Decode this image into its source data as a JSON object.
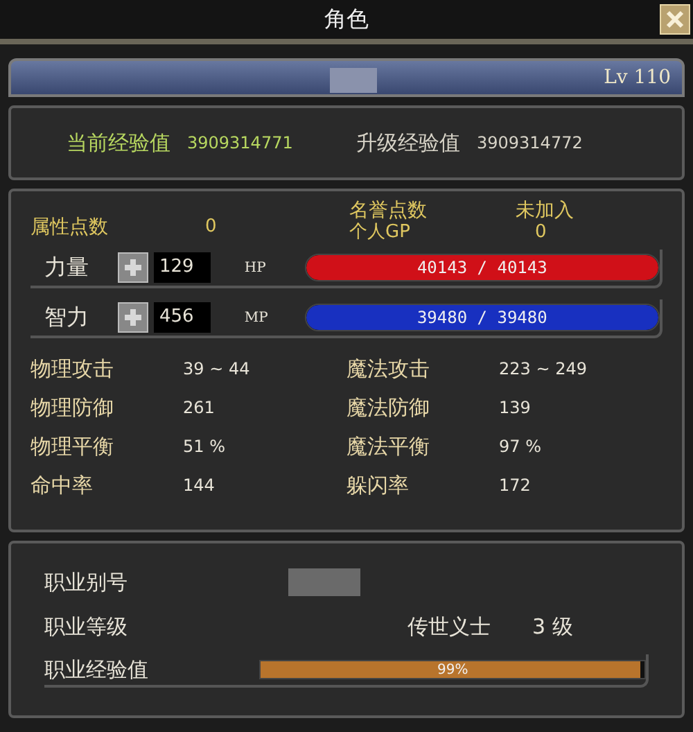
{
  "window": {
    "title": "角色"
  },
  "level_bar": {
    "level_text": "Lv 110"
  },
  "experience": {
    "current_label": "当前经验值",
    "current_value": "3909314771",
    "next_label": "升级经验值",
    "next_value": "3909314772"
  },
  "points": {
    "attr_label": "属性点数",
    "attr_value": "0",
    "honor_label": "名誉点数",
    "honor_value": "未加入",
    "gp_label": "个人GP",
    "gp_value": "0"
  },
  "resources": [
    {
      "stat_label": "力量",
      "stat_value": "129",
      "bar_label": "HP",
      "reading": "40143 / 40143",
      "level": 1.0,
      "color": "#d01018"
    },
    {
      "stat_label": "智力",
      "stat_value": "456",
      "bar_label": "MP",
      "reading": "39480 / 39480",
      "level": 1.0,
      "color": "#1830c0"
    }
  ],
  "stats": [
    {
      "label": "物理攻击",
      "value": "39 ~ 44"
    },
    {
      "label": "魔法攻击",
      "value": "223 ~ 249"
    },
    {
      "label": "物理防御",
      "value": "261"
    },
    {
      "label": "魔法防御",
      "value": "139"
    },
    {
      "label": "物理平衡",
      "value": "51 %"
    },
    {
      "label": "魔法平衡",
      "value": "97 %"
    },
    {
      "label": "命中率",
      "value": "144"
    },
    {
      "label": "躲闪率",
      "value": "172"
    }
  ],
  "job": {
    "alias_label": "职业别号",
    "level_label": "职业等级",
    "level_name": "传世义士",
    "level_value": "3 级",
    "exp_label": "职业经验值",
    "exp_reading": "99%",
    "level": 0.99
  }
}
